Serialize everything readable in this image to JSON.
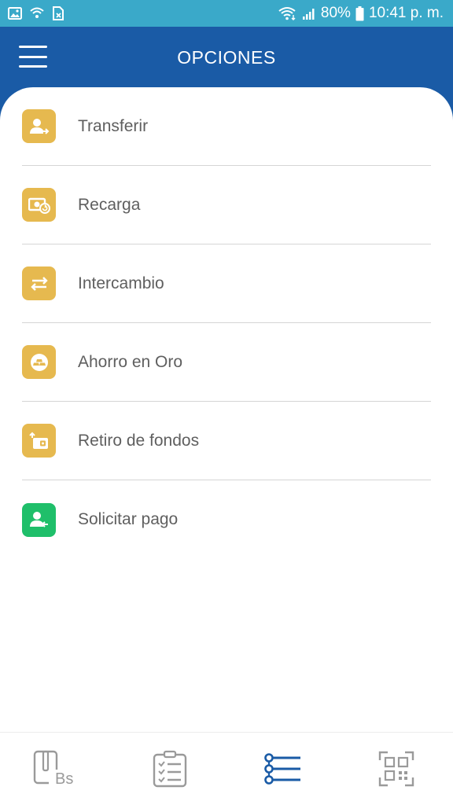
{
  "status_bar": {
    "battery": "80%",
    "time": "10:41 p. m."
  },
  "app_bar": {
    "title": "OPCIONES",
    "menu_icon": "hamburger-menu-icon"
  },
  "menu": {
    "items": [
      {
        "label": "Transferir",
        "icon": "user-send-icon",
        "color": "#e6b94f"
      },
      {
        "label": "Recarga",
        "icon": "cash-refresh-icon",
        "color": "#e6b94f"
      },
      {
        "label": "Intercambio",
        "icon": "swap-arrows-icon",
        "color": "#e6b94f"
      },
      {
        "label": "Ahorro en Oro",
        "icon": "gold-bars-icon",
        "color": "#e6b94f"
      },
      {
        "label": "Retiro de fondos",
        "icon": "wallet-withdraw-icon",
        "color": "#e6b94f"
      },
      {
        "label": "Solicitar pago",
        "icon": "user-request-icon",
        "color": "#1fbf6a"
      }
    ]
  },
  "bottom_nav": {
    "items": [
      {
        "icon": "phone-bs-icon",
        "label": "Bs",
        "active": false
      },
      {
        "icon": "checklist-icon",
        "active": false
      },
      {
        "icon": "options-list-icon",
        "active": true
      },
      {
        "icon": "qr-code-icon",
        "active": false
      }
    ],
    "active_color": "#1a5ba6",
    "inactive_color": "#9a9a9a"
  },
  "colors": {
    "header": "#1a5ba6",
    "status_bar": "#3aa9c9",
    "gold": "#e6b94f",
    "green": "#1fbf6a"
  }
}
